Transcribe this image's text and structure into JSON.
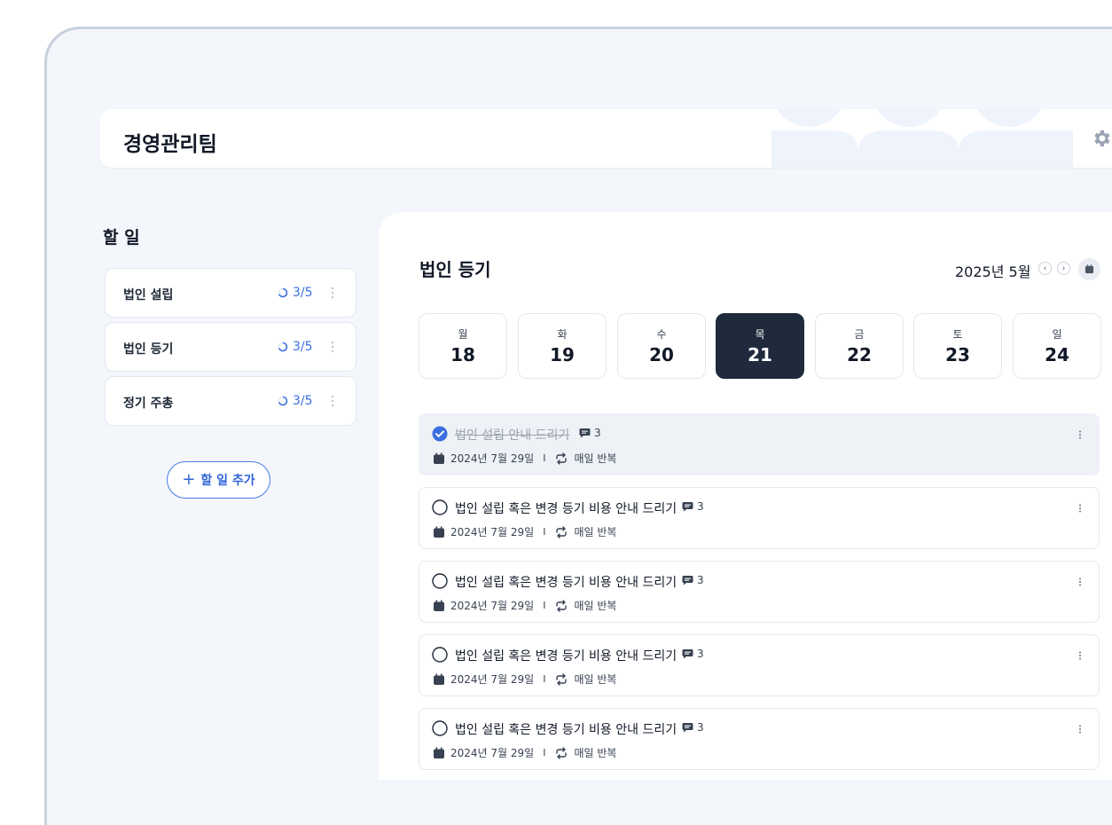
{
  "header": {
    "team_name": "경영관리팀",
    "settings_icon": "gear-icon"
  },
  "todos": {
    "title": "할 일",
    "items": [
      {
        "label": "법인 설립",
        "progress": "3/5"
      },
      {
        "label": "법인 등기",
        "progress": "3/5"
      },
      {
        "label": "정기 주총",
        "progress": "3/5"
      }
    ],
    "add_label": "할 일 추가",
    "add_symbol": "+"
  },
  "main": {
    "title": "법인 등기",
    "month": "2025년 5월",
    "prev_symbol": "‹",
    "next_symbol": "›",
    "days": [
      {
        "weekday": "월",
        "date": "18"
      },
      {
        "weekday": "화",
        "date": "19"
      },
      {
        "weekday": "수",
        "date": "20"
      },
      {
        "weekday": "목",
        "date": "21"
      },
      {
        "weekday": "금",
        "date": "22"
      },
      {
        "weekday": "토",
        "date": "23"
      },
      {
        "weekday": "일",
        "date": "24"
      }
    ],
    "selected_day": "21",
    "tasks": [
      {
        "title": "법인 설립 안내 드리기",
        "comments": "3",
        "date": "2024년 7월 29일",
        "separator": "I",
        "repeat": "매일 반복",
        "done": true
      },
      {
        "title": "법인 설립 혹은 변경 등기 비용 안내 드리기",
        "comments": "3",
        "date": "2024년 7월 29일",
        "separator": "I",
        "repeat": "매일 반복",
        "done": false
      },
      {
        "title": "법인 설립 혹은 변경 등기 비용 안내 드리기",
        "comments": "3",
        "date": "2024년 7월 29일",
        "separator": "I",
        "repeat": "매일 반복",
        "done": false
      },
      {
        "title": "법인 설립 혹은 변경 등기 비용 안내 드리기",
        "comments": "3",
        "date": "2024년 7월 29일",
        "separator": "I",
        "repeat": "매일 반복",
        "done": false
      },
      {
        "title": "법인 설립 혹은 변경 등기 비용 안내 드리기",
        "comments": "3",
        "date": "2024년 7월 29일",
        "separator": "I",
        "repeat": "매일 반복",
        "done": false
      }
    ]
  },
  "colors": {
    "accent": "#3b6fe0",
    "selected_day_bg": "#1f2a3d",
    "canvas_bg": "#f3f6fb",
    "done_task_bg": "#eef2f7"
  }
}
